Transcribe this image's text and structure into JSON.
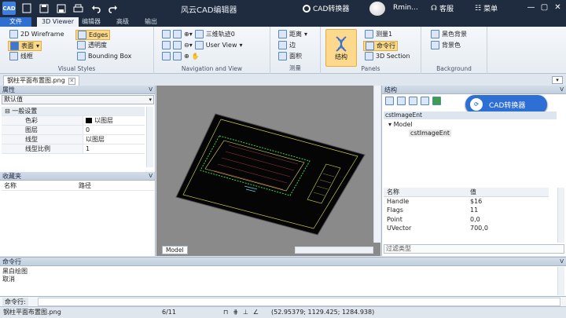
{
  "titlebar": {
    "logo": "CAD",
    "title": "风云CAD编辑器",
    "cad_convert": "CAD转换器",
    "user": "Rmin...",
    "service": "客服",
    "menu": "菜单",
    "icons": [
      "new-file-icon",
      "save-icon",
      "print-icon",
      "undo-icon",
      "redo-icon"
    ],
    "minimize": "—",
    "maximize": "▢",
    "close": "✕"
  },
  "ribbon_tabs": [
    "文件",
    "3D Viewer",
    "编辑器",
    "高级",
    "输出"
  ],
  "ribbon": {
    "visual_styles": {
      "title": "Visual Styles",
      "wireframe": "2D Wireframe",
      "surface": "表面",
      "frame": "线框",
      "edges": "Edges",
      "transparency": "透明度",
      "bbox": "Bounding Box"
    },
    "navigation": {
      "title": "Navigation and View",
      "orbit": "三维轨迹0",
      "user_view": "User View"
    },
    "measure": {
      "title": "测量",
      "distance": "距离",
      "edge": "边",
      "area": "面积"
    },
    "panels": {
      "title": "Panels",
      "structure": "结构",
      "measure1": "测量1",
      "command": "命令行",
      "section3d": "3D Section"
    },
    "background": {
      "title": "Background",
      "black": "黑色背景",
      "bgcolor": "背景色"
    }
  },
  "doc_tab": {
    "name": "钢柱平面布置图.png",
    "close": "✕"
  },
  "properties": {
    "title": "属性",
    "select": "默认值",
    "category": "一般设置",
    "rows": [
      {
        "key": "色彩",
        "value": "以图层"
      },
      {
        "key": "图层",
        "value": "0"
      },
      {
        "key": "线型",
        "value": "以图层"
      },
      {
        "key": "线型比例",
        "value": "1"
      }
    ]
  },
  "favorites": {
    "title": "收藏夹",
    "col_name": "名称",
    "col_path": "路径"
  },
  "drawing": {
    "model_tab": "Model"
  },
  "structure": {
    "title": "结构",
    "convert_button": "CAD转换器",
    "tree_head": "cstImageEnt",
    "tree_root": "Model",
    "tree_child": "cstImageEnt",
    "attr_head": {
      "name": "名称",
      "value": "值"
    },
    "attrs": [
      {
        "name": "Handle",
        "value": "$16"
      },
      {
        "name": "Flags",
        "value": "11"
      },
      {
        "name": "Point",
        "value": "0,0"
      },
      {
        "name": "UVector",
        "value": "700,0"
      }
    ],
    "filter": "过滤类型"
  },
  "command": {
    "title": "命令行",
    "lines": [
      "黑白绘图",
      "取消"
    ],
    "prompt": "命令行:"
  },
  "status": {
    "file": "钢柱平面布置图.png",
    "page": "6/11",
    "coords": "(52.95379; 1129.425; 1284.938)"
  }
}
